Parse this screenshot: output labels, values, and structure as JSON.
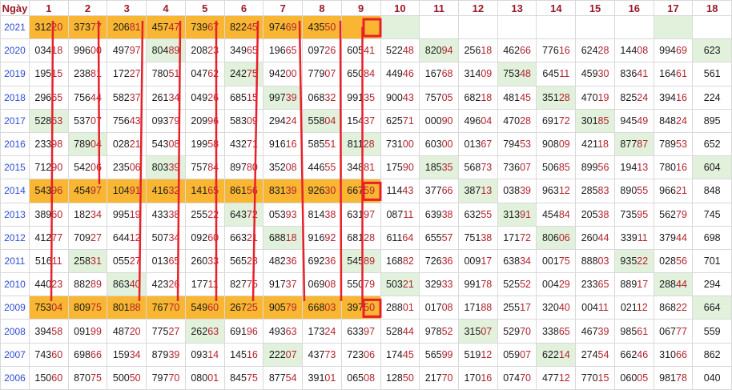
{
  "header": {
    "corner_label": "Ngày",
    "columns": [
      "1",
      "2",
      "3",
      "4",
      "5",
      "6",
      "7",
      "8",
      "9",
      "10",
      "11",
      "12",
      "13",
      "14",
      "15",
      "16",
      "17",
      "18"
    ]
  },
  "rows": [
    {
      "year": "2021",
      "cells": [
        "31220",
        "37377",
        "20681",
        "45747",
        "73967",
        "82245",
        "97469",
        "43550",
        "",
        "",
        "",
        "",
        "",
        "",
        "",
        "",
        "",
        ""
      ]
    },
    {
      "year": "2020",
      "cells": [
        "03418",
        "99600",
        "49797",
        "80489",
        "20823",
        "34965",
        "19665",
        "09726",
        "60541",
        "52248",
        "82094",
        "25618",
        "46266",
        "77616",
        "62428",
        "14408",
        "99469",
        "623"
      ]
    },
    {
      "year": "2019",
      "cells": [
        "19515",
        "23881",
        "17227",
        "78051",
        "04762",
        "24275",
        "94200",
        "77907",
        "65084",
        "44946",
        "16768",
        "31409",
        "75348",
        "64511",
        "45930",
        "83641",
        "16461",
        "561"
      ]
    },
    {
      "year": "2018",
      "cells": [
        "29665",
        "75644",
        "58237",
        "26134",
        "04926",
        "68515",
        "99739",
        "06832",
        "99135",
        "90043",
        "75705",
        "68218",
        "48145",
        "35128",
        "47019",
        "82524",
        "39416",
        "224"
      ]
    },
    {
      "year": "2017",
      "cells": [
        "52863",
        "53707",
        "75643",
        "09379",
        "20996",
        "58309",
        "29424",
        "55804",
        "15437",
        "62571",
        "00090",
        "49604",
        "47028",
        "69172",
        "30185",
        "94549",
        "84824",
        "895"
      ]
    },
    {
      "year": "2016",
      "cells": [
        "23398",
        "78904",
        "02821",
        "54308",
        "19958",
        "43271",
        "91616",
        "58551",
        "81128",
        "73100",
        "60300",
        "01367",
        "79453",
        "90809",
        "42118",
        "87787",
        "78953",
        "652"
      ]
    },
    {
      "year": "2015",
      "cells": [
        "71290",
        "54206",
        "23506",
        "80339",
        "75784",
        "89780",
        "35208",
        "44655",
        "34881",
        "17590",
        "18535",
        "56873",
        "73607",
        "50685",
        "89956",
        "19413",
        "78016",
        "604"
      ]
    },
    {
      "year": "2014",
      "cells": [
        "54396",
        "45497",
        "10491",
        "41632",
        "14165",
        "86156",
        "83139",
        "92630",
        "66759",
        "11443",
        "37766",
        "38713",
        "03839",
        "96312",
        "28583",
        "89055",
        "96621",
        "848"
      ]
    },
    {
      "year": "2013",
      "cells": [
        "38960",
        "18234",
        "99519",
        "43338",
        "25522",
        "64372",
        "05393",
        "81438",
        "63197",
        "08711",
        "63938",
        "63255",
        "31391",
        "45484",
        "20538",
        "73595",
        "56279",
        "745"
      ]
    },
    {
      "year": "2012",
      "cells": [
        "41277",
        "70927",
        "64412",
        "50734",
        "09260",
        "66321",
        "68818",
        "91692",
        "68128",
        "61164",
        "65557",
        "75138",
        "17172",
        "80606",
        "26044",
        "33911",
        "37944",
        "698"
      ]
    },
    {
      "year": "2011",
      "cells": [
        "51611",
        "25831",
        "05527",
        "01365",
        "26033",
        "56528",
        "48236",
        "69236",
        "54589",
        "16882",
        "72636",
        "00917",
        "63834",
        "00175",
        "88803",
        "93522",
        "02856",
        "701"
      ]
    },
    {
      "year": "2010",
      "cells": [
        "44023",
        "88289",
        "86340",
        "42326",
        "17711",
        "82775",
        "91737",
        "06908",
        "55079",
        "50321",
        "32933",
        "99178",
        "52552",
        "00429",
        "23365",
        "88917",
        "28844",
        "294"
      ]
    },
    {
      "year": "2009",
      "cells": [
        "75304",
        "80975",
        "80188",
        "76770",
        "54960",
        "26725",
        "90579",
        "66803",
        "39750",
        "28801",
        "01708",
        "17188",
        "25517",
        "32040",
        "00411",
        "02112",
        "86822",
        "664"
      ]
    },
    {
      "year": "2008",
      "cells": [
        "39458",
        "09199",
        "48720",
        "77527",
        "26263",
        "69196",
        "49363",
        "17324",
        "63397",
        "52844",
        "97852",
        "31507",
        "52970",
        "33865",
        "46739",
        "98561",
        "06777",
        "559"
      ]
    },
    {
      "year": "2007",
      "cells": [
        "74360",
        "69866",
        "15934",
        "87939",
        "09314",
        "14516",
        "22207",
        "43773",
        "72306",
        "17445",
        "56599",
        "51912",
        "05907",
        "62214",
        "27454",
        "66246",
        "31066",
        "862"
      ]
    },
    {
      "year": "2006",
      "cells": [
        "15060",
        "87075",
        "50050",
        "79770",
        "08001",
        "84575",
        "87754",
        "39101",
        "06508",
        "12850",
        "21770",
        "17016",
        "07470",
        "47712",
        "77015",
        "06005",
        "98178",
        "040"
      ]
    }
  ],
  "colors": {
    "highlight": "#f8b633",
    "green": "#e1f1dc",
    "line": "#e8202a",
    "year": "#2c4bd6",
    "header": "#9b1a2a",
    "tail": "#b3232e"
  }
}
